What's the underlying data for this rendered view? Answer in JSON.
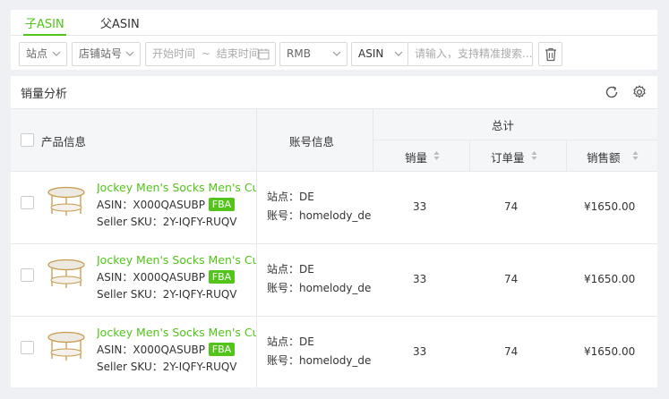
{
  "tabs": [
    {
      "label": "子ASIN",
      "active": true
    },
    {
      "label": "父ASIN",
      "active": false
    }
  ],
  "filters": {
    "site_select": "站点",
    "store_select": "店铺站号",
    "date_range": {
      "start_placeholder": "开始时间",
      "separator": "~",
      "end_placeholder": "结束时间"
    },
    "currency_select": "RMB",
    "search_type_select": "ASIN",
    "search_placeholder": "请输入，支持精准搜索..."
  },
  "section": {
    "title": "销量分析"
  },
  "table": {
    "headers": {
      "product": "产品信息",
      "account": "账号信息",
      "total_group": "总计",
      "sales_qty": "销量",
      "orders": "订单量",
      "revenue": "销售额"
    },
    "rows": [
      {
        "title": "Jockey Men's Socks Men's Cushi",
        "asin_label": "ASIN：",
        "asin": "X000QASUBP",
        "badge": "FBA",
        "sku_label": "Seller SKU：",
        "sku": "2Y-IQFY-RUQV",
        "site_label": "站点：",
        "site": "DE",
        "account_label": "账号：",
        "account": "homelody_de",
        "sales_qty": "33",
        "orders": "74",
        "revenue": "¥1650.00"
      },
      {
        "title": "Jockey Men's Socks Men's Cushi",
        "asin_label": "ASIN：",
        "asin": "X000QASUBP",
        "badge": "FBA",
        "sku_label": "Seller SKU：",
        "sku": "2Y-IQFY-RUQV",
        "site_label": "站点：",
        "site": "DE",
        "account_label": "账号：",
        "account": "homelody_de",
        "sales_qty": "33",
        "orders": "74",
        "revenue": "¥1650.00"
      },
      {
        "title": "Jockey Men's Socks Men's Cushi",
        "asin_label": "ASIN：",
        "asin": "X000QASUBP",
        "badge": "FBA",
        "sku_label": "Seller SKU：",
        "sku": "2Y-IQFY-RUQV",
        "site_label": "站点：",
        "site": "DE",
        "account_label": "账号：",
        "account": "homelody_de",
        "sales_qty": "33",
        "orders": "74",
        "revenue": "¥1650.00"
      }
    ]
  },
  "colors": {
    "accent": "#52c41a",
    "header_bg": "#f5f6f8",
    "page_bg": "#eef0f3"
  },
  "icons": [
    "chevron-down-icon",
    "calendar-icon",
    "trash-icon",
    "refresh-icon",
    "gear-icon",
    "sort-icon",
    "table-thumbnail"
  ]
}
